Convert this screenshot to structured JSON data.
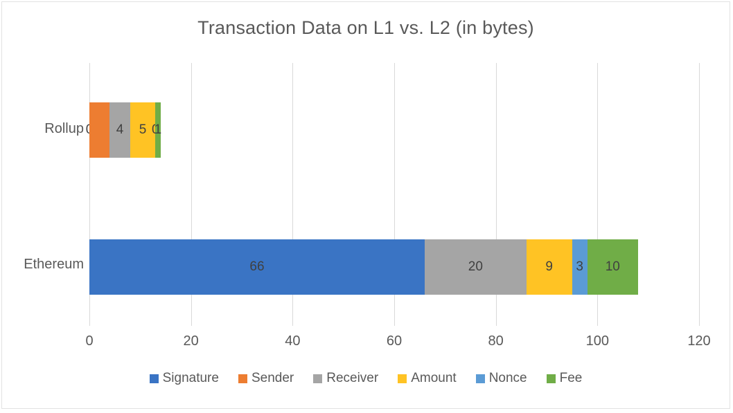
{
  "chart_data": {
    "type": "bar",
    "orientation": "horizontal",
    "stacked": true,
    "title": "Transaction Data on L1 vs. L2 (in bytes)",
    "xlabel": "",
    "ylabel": "",
    "xlim": [
      0,
      120
    ],
    "xticks": [
      0,
      20,
      40,
      60,
      80,
      100,
      120
    ],
    "xtick_labels": [
      "0",
      "20",
      "40",
      "60",
      "80",
      "100",
      "120"
    ],
    "grid": "vertical",
    "legend_position": "bottom",
    "categories": [
      "Ethereum",
      "Rollup"
    ],
    "category_order_top_to_bottom": [
      "Rollup",
      "Ethereum"
    ],
    "series": [
      {
        "name": "Signature",
        "color": "#3A74C4",
        "values": [
          66,
          0
        ]
      },
      {
        "name": "Sender",
        "color": "#ED7D31",
        "values": [
          0,
          4
        ]
      },
      {
        "name": "Receiver",
        "color": "#A5A5A5",
        "values": [
          20,
          4
        ]
      },
      {
        "name": "Amount",
        "color": "#FFC324",
        "values": [
          9,
          5
        ]
      },
      {
        "name": "Nonce",
        "color": "#5B9BD5",
        "values": [
          3,
          0
        ]
      },
      {
        "name": "Fee",
        "color": "#70AD47",
        "values": [
          10,
          1
        ]
      }
    ],
    "totals": {
      "Ethereum": 108,
      "Rollup": 14
    },
    "data_labels": {
      "Rollup": [
        "0",
        "4",
        "5",
        "0",
        "1"
      ],
      "Ethereum": [
        "66",
        "20",
        "9",
        "3",
        "10"
      ]
    }
  },
  "title": "Transaction Data on L1 vs. L2 (in bytes)",
  "axis": {
    "x_ticks": [
      "0",
      "20",
      "40",
      "60",
      "80",
      "100",
      "120"
    ],
    "categories": {
      "rollup": "Rollup",
      "ethereum": "Ethereum"
    }
  },
  "legend": {
    "items": [
      {
        "label": "Signature",
        "color": "#3A74C4"
      },
      {
        "label": "Sender",
        "color": "#ED7D31"
      },
      {
        "label": "Receiver",
        "color": "#A5A5A5"
      },
      {
        "label": "Amount",
        "color": "#FFC324"
      },
      {
        "label": "Nonce",
        "color": "#5B9BD5"
      },
      {
        "label": "Fee",
        "color": "#70AD47"
      }
    ]
  },
  "bars": {
    "rollup": [
      {
        "series": "Signature",
        "value": 0,
        "label": "0",
        "color": "#3A74C4"
      },
      {
        "series": "Sender",
        "value": 4,
        "label": "",
        "color": "#ED7D31"
      },
      {
        "series": "Receiver",
        "value": 4,
        "label": "4",
        "color": "#A5A5A5"
      },
      {
        "series": "Amount",
        "value": 5,
        "label": "5",
        "color": "#FFC324"
      },
      {
        "series": "Nonce",
        "value": 0,
        "label": "0",
        "color": "#5B9BD5"
      },
      {
        "series": "Fee",
        "value": 1,
        "label": "1",
        "color": "#70AD47"
      }
    ],
    "ethereum": [
      {
        "series": "Signature",
        "value": 66,
        "label": "66",
        "color": "#3A74C4"
      },
      {
        "series": "Sender",
        "value": 0,
        "label": "",
        "color": "#ED7D31"
      },
      {
        "series": "Receiver",
        "value": 20,
        "label": "20",
        "color": "#A5A5A5"
      },
      {
        "series": "Amount",
        "value": 9,
        "label": "9",
        "color": "#FFC324"
      },
      {
        "series": "Nonce",
        "value": 3,
        "label": "3",
        "color": "#5B9BD5"
      },
      {
        "series": "Fee",
        "value": 10,
        "label": "10",
        "color": "#70AD47"
      }
    ]
  }
}
